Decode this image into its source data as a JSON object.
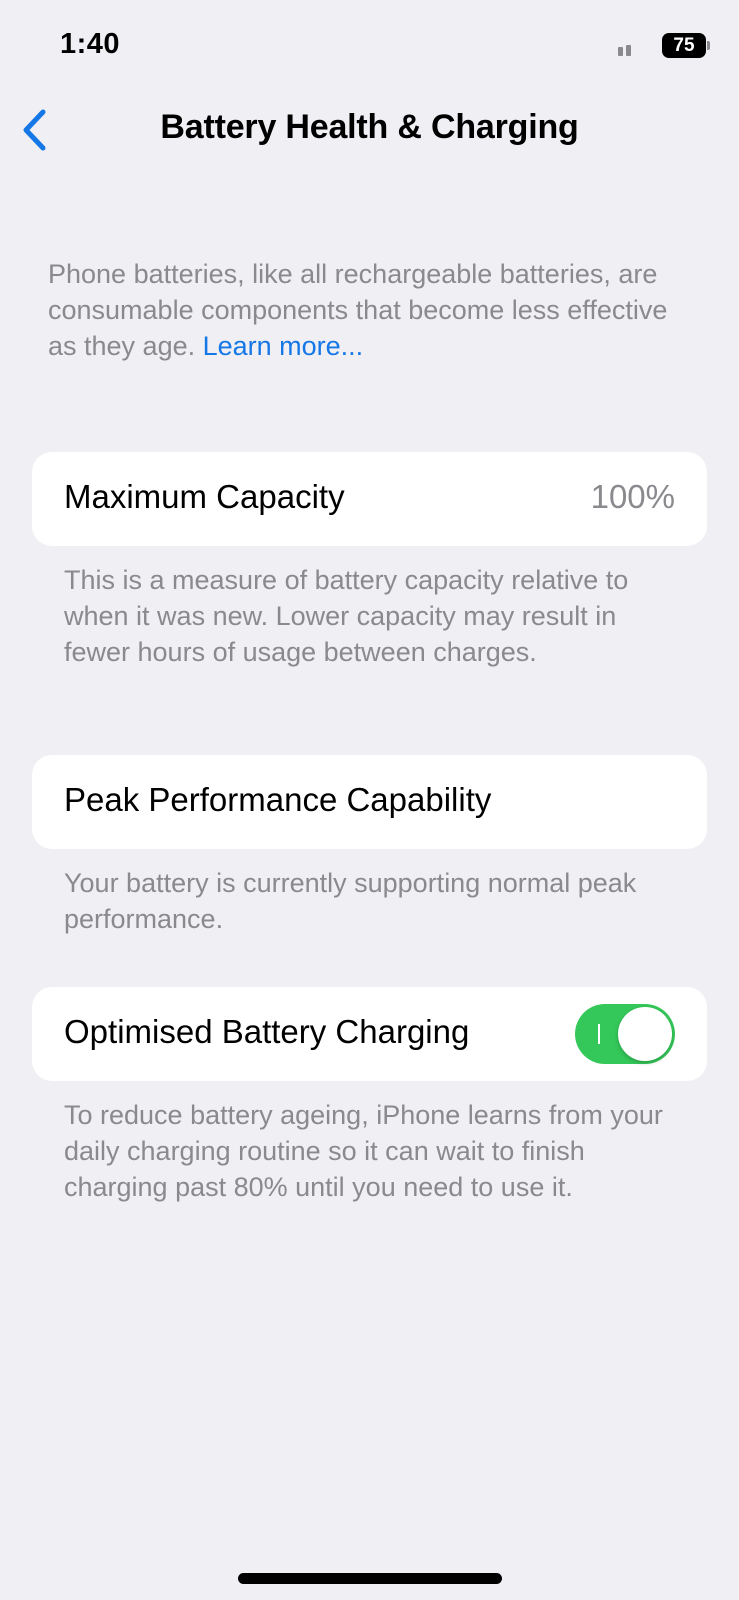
{
  "status_bar": {
    "time": "1:40",
    "battery_level": "75"
  },
  "nav": {
    "title": "Battery Health & Charging",
    "back_icon": "chevron-left-icon"
  },
  "intro": {
    "text": "Phone batteries, like all rechargeable batteries, are consumable components that become less effective as they age. ",
    "link": "Learn more..."
  },
  "maximum_capacity": {
    "label": "Maximum Capacity",
    "value": "100%",
    "footnote": "This is a measure of battery capacity relative to when it was new. Lower capacity may result in fewer hours of usage between charges."
  },
  "peak_performance": {
    "label": "Peak Performance Capability",
    "footnote": "Your battery is currently supporting normal peak performance."
  },
  "optimised_charging": {
    "label": "Optimised Battery Charging",
    "enabled": true,
    "footnote": "To reduce battery ageing, iPhone learns from your daily charging routine so it can wait to finish charging past 80% until you need to use it."
  },
  "colors": {
    "accent": "#1677e6",
    "toggle_on": "#34c759",
    "background": "#efeff4",
    "secondary_text": "#8a8a8e"
  }
}
